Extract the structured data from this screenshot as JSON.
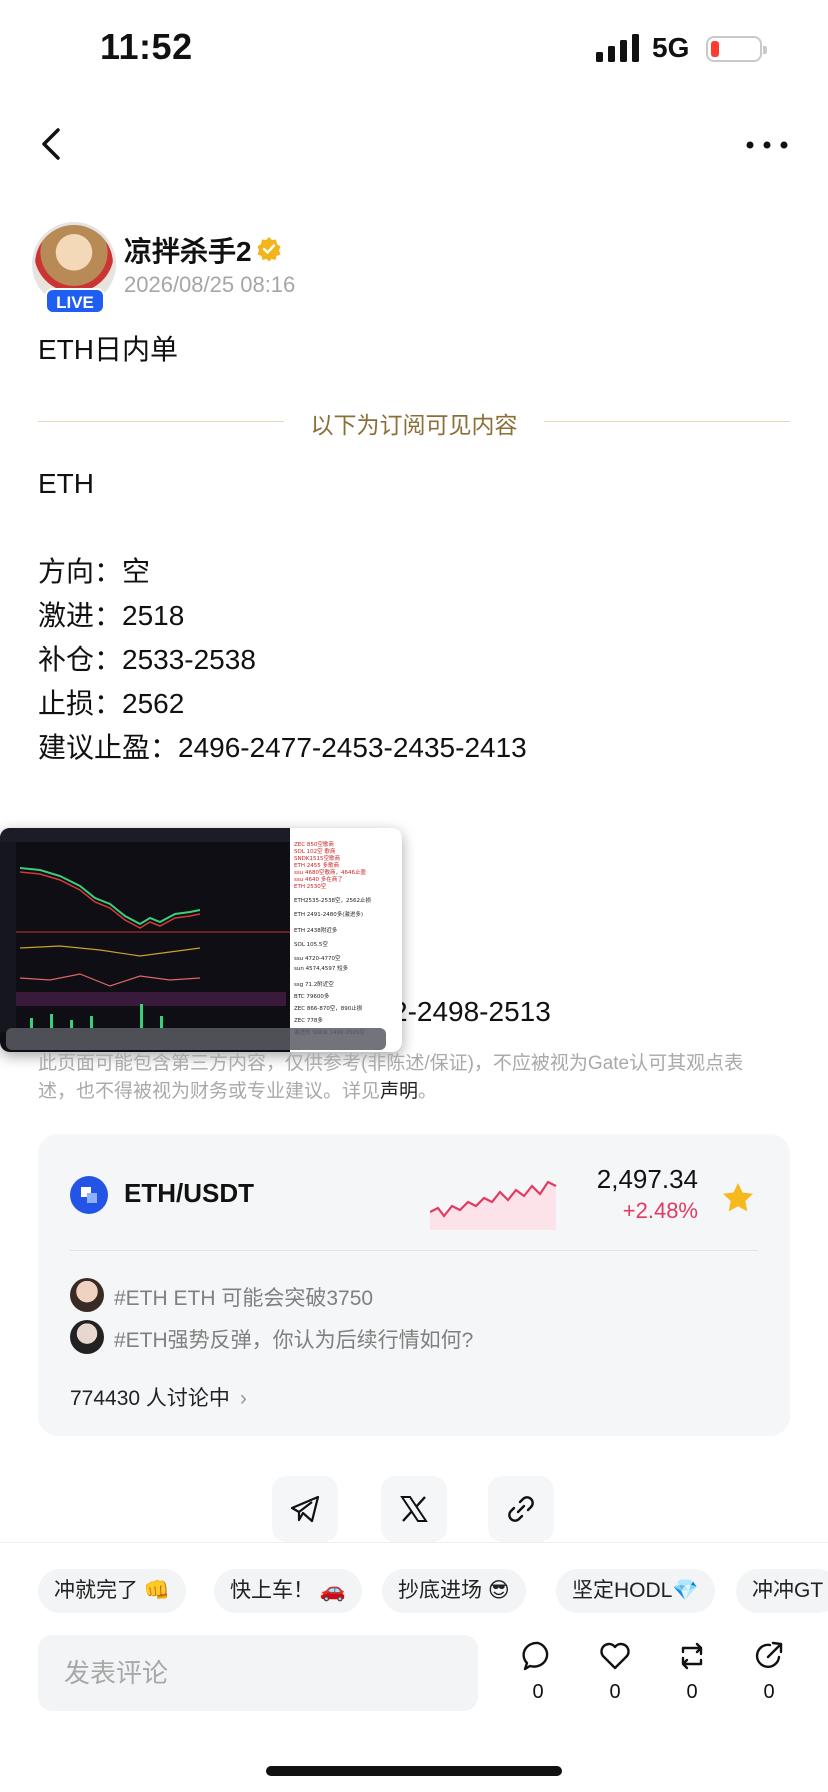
{
  "status_bar": {
    "time": "11:52",
    "network": "5G"
  },
  "author": {
    "name": "凉拌杀手2",
    "live_badge": "LIVE",
    "timestamp": "2026/08/25 08:16"
  },
  "post": {
    "title": "ETH日内单",
    "subscriber_divider": "以下为订阅可见内容",
    "symbol": "ETH",
    "lines": [
      "方向：空",
      "激进：2518",
      "补仓：2533-2538",
      "止损：2562",
      "建议止盈：2496-2477-2453-2435-2413"
    ],
    "partial_line": "2-2498-2513"
  },
  "screenshot_overlay": {
    "notes": [
      "ZEC 850空歌商",
      "SOL 102空 歌商",
      "SNDK1515空歌商",
      "ETH 2455 多歌商",
      "ssu 4680空歌商，4646止盈",
      "ssu 4640 多在商了",
      "ETH 2530空",
      "ETH2535-2538空，2562止损",
      "ETH 2491-2480多(激进多)",
      "ETH 2438附近多",
      "SOL 105.5空",
      "ssu 4720-4770空",
      "sun 4574,4597 短多",
      "ssg 71.2附近空",
      "BTC 79600多",
      "ZEC 866-870空，890止损",
      "ZEC 778多",
      "激进的 SNDK 1490-1505空"
    ]
  },
  "disclaimer": {
    "text": "此页面可能包含第三方内容，仅供参考(非陈述/保证)，不应被视为Gate认可其观点表述，也不得被视为财务或专业建议。详见",
    "link": "声明",
    "tail": "。"
  },
  "market": {
    "pair": "ETH/USDT",
    "price": "2,497.34",
    "change": "+2.48%",
    "accent_color": "#e23a61",
    "topics": [
      "#ETH ETH 可能会突破3750",
      "#ETH强势反弹，你认为后续行情如何?"
    ],
    "discussion": "774430 人讨论中"
  },
  "share_icons": [
    "telegram-icon",
    "x-icon",
    "link-icon"
  ],
  "quick_replies": [
    "冲就完了 👊",
    "快上车！ 🚗",
    "抄底进场 😎",
    "坚定HODL💎",
    "冲冲GT"
  ],
  "comment": {
    "placeholder": "发表评论",
    "actions": [
      {
        "icon": "comment-icon",
        "count": "0"
      },
      {
        "icon": "like-icon",
        "count": "0"
      },
      {
        "icon": "repost-icon",
        "count": "0"
      },
      {
        "icon": "share-icon",
        "count": "0"
      }
    ]
  }
}
